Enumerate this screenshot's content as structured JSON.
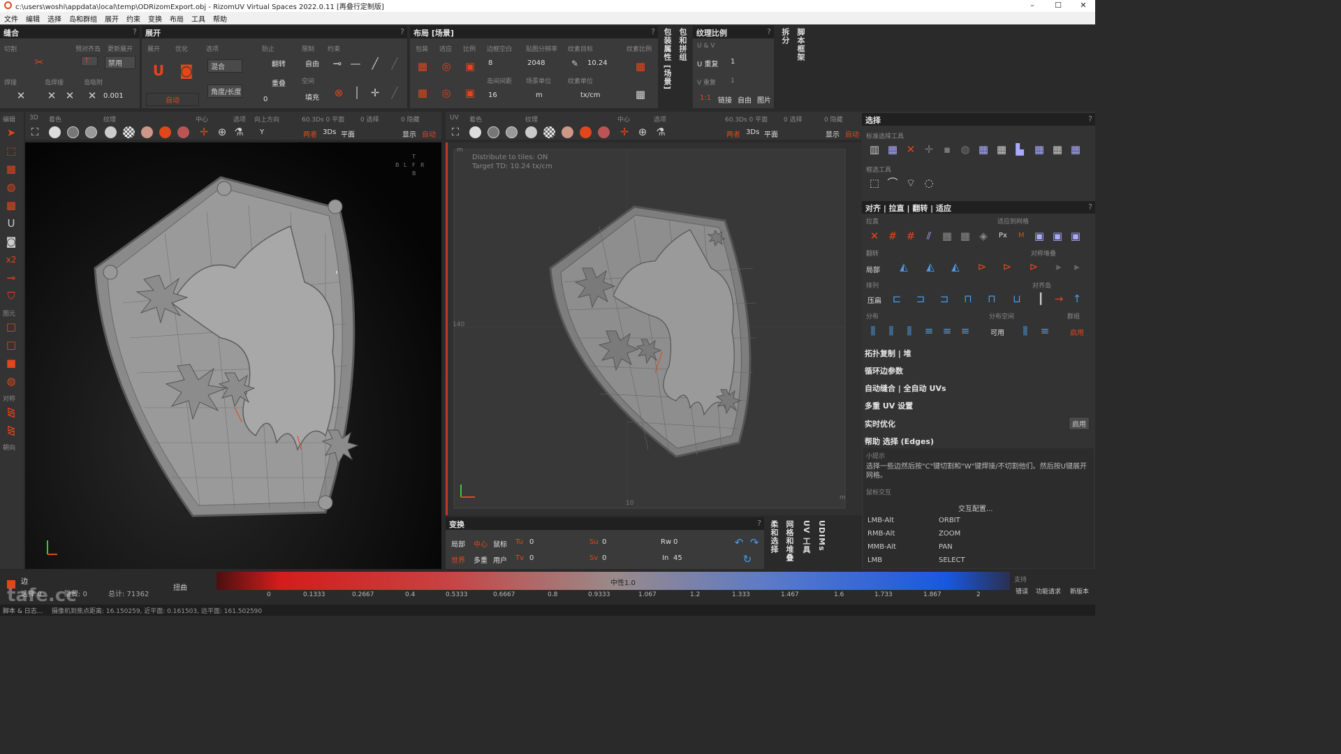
{
  "window": {
    "title": "c:\\users\\woshi\\appdata\\local\\temp\\ODRizomExport.obj - RizomUV Virtual Spaces 2022.0.11 [再叠行定制版]",
    "min": "–",
    "max": "☐",
    "close": "✕"
  },
  "menu": [
    "文件",
    "编辑",
    "选择",
    "岛和群组",
    "展开",
    "约束",
    "变换",
    "布局",
    "工具",
    "帮助"
  ],
  "seams": {
    "title": "缝合",
    "help": "?",
    "cut": "切割",
    "auto_align": "预对齐岛",
    "update_unfold": "更新展开",
    "disabled": "禁用",
    "weld": "焊接",
    "weld_island": "岛焊接",
    "weld_attach": "岛吸附",
    "value": "0.001",
    "t_label": "T"
  },
  "unfold": {
    "title": "展开",
    "help": "?",
    "unfold": "展开",
    "optimize": "优化",
    "options": "选项",
    "prevent": "防止",
    "limit": "限制",
    "constraint": "约束",
    "mix": "混合",
    "angle_len": "角度/长度",
    "flip": "翻转",
    "overlap": "重叠",
    "free": "自由",
    "empty": "空间",
    "fill": "填充",
    "auto": "自动",
    "zero": "0"
  },
  "layout": {
    "title": "布局 [场景]",
    "help": "?",
    "pack": "包装",
    "fit": "适应",
    "ratio": "比例",
    "margin": "边框空白",
    "resolution": "贴图分辨率",
    "texel_target": "纹素目标",
    "texel_ratio": "纹素比例",
    "margin_val": "8",
    "res_val": "2048",
    "td_val": "10.24",
    "spacing": "岛间间距",
    "spacing_val": "16",
    "scene_unit": "场景单位",
    "unit_val": "m",
    "texel_unit": "纹素单位",
    "texel_unit_val": "tx/cm"
  },
  "texel": {
    "title": "纹理比例",
    "help": "?",
    "uv": "U & V",
    "u_repeat": "U 重复",
    "u_val": "1",
    "v_repeat": "V 重复",
    "v_val": "1",
    "ratio": "1:1",
    "link": "链接",
    "free": "自由",
    "image": "图片"
  },
  "vtabs": {
    "pack_props": "包装属性 [场景]",
    "wrap": "包和拼组",
    "unfold_t": "拆分",
    "script": "脚本框架"
  },
  "toolbar3d": {
    "edit": "编辑",
    "view": "3D",
    "color": "着色",
    "texture": "纹理",
    "center": "中心",
    "select": "选项",
    "up": "向上方向",
    "up_val": "Y",
    "info": "60.3Ds 0 平面",
    "sel": "0 选择",
    "hidden": "0 隐藏",
    "both": "两者",
    "d3": "3Ds",
    "flat": "平面",
    "show": "显示",
    "auto": "自动"
  },
  "toolbaruv": {
    "view": "UV",
    "color": "着色",
    "texture": "纹理",
    "center": "中心",
    "select": "选项",
    "info": "60.3Ds 0 平面",
    "sel": "0 选择",
    "hidden": "0 隐藏",
    "both": "两者",
    "d3": "3Ds",
    "flat": "平面",
    "show": "显示",
    "auto": "自动"
  },
  "left_tools": {
    "primitives": "图元",
    "align": "对称",
    "orient": "朝向"
  },
  "viewcube": {
    "t": "T",
    "b": "B",
    "l": "L",
    "f": "F",
    "r": "R",
    "bk": "B"
  },
  "uvview": {
    "distribute": "Distribute to tiles: ON",
    "target": "Target TD: 10.24 tx/cm",
    "y_mark": "140",
    "x_mark": "10",
    "m": "m",
    "m2": "m"
  },
  "transform": {
    "title": "变换",
    "help": "?",
    "local": "局部",
    "center": "中心",
    "mouse": "鼠标",
    "world": "世界",
    "multi": "多重",
    "user": "用户",
    "tu": "Tu",
    "tu_val": "0",
    "tv": "Tv",
    "tv_val": "0",
    "su": "Su",
    "su_val": "0",
    "sv": "Sv",
    "sv_val": "0",
    "rw": "Rw",
    "rw_val": "0",
    "in": "In",
    "in_val": "45"
  },
  "vtabs2": {
    "a": "柔和选择",
    "b": "网格和堆叠",
    "c": "UV 工具",
    "d": "UDIMs"
  },
  "select_panel": {
    "title": "选择",
    "help": "?",
    "std_tools": "标准选择工具",
    "lasso_tools": "框选工具"
  },
  "align_panel": {
    "title": "对齐 | 拉直 | 翻转 | 适应",
    "help": "?",
    "straighten": "拉直",
    "snap_grid": "适应到网格",
    "px": "Px",
    "m": "M",
    "flip": "翻转",
    "local": "局部",
    "sym_stack": "对称堆叠",
    "arrange": "排列",
    "align_to": "对齐岛",
    "compress": "压扁",
    "distribute": "分布",
    "dist_space": "分布空间",
    "group": "群组",
    "usable": "可用",
    "apply": "启用"
  },
  "sections": [
    "拓扑复制 | 堆",
    "循环边参数",
    "自动缝合 | 全自动 UVs",
    "多重 UV 设置",
    "实时优化",
    "帮助 选择 (Edges)"
  ],
  "realtime_btn": "启用",
  "help": {
    "tips": "小提示",
    "text": "选择一些边然后按\"C\"键切割和\"W\"键焊接/不切割他们。然后按U键展开网格。",
    "mouse": "鼠标交互",
    "config": "交互配置...",
    "keys": [
      [
        "LMB-Alt",
        "ORBIT"
      ],
      [
        "RMB-Alt",
        "ZOOM"
      ],
      [
        "MMB-Alt",
        "PAN"
      ],
      [
        "LMB",
        "SELECT"
      ]
    ]
  },
  "status": {
    "edge": "边",
    "selected": "选择:0",
    "hidden": "隐藏: 0",
    "total": "总计: 71362",
    "distort": "扭曲",
    "neutral": "中性1.0",
    "scale": [
      "0",
      "0.1333",
      "0.2667",
      "0.4",
      "0.5333",
      "0.6667",
      "0.8",
      "0.9333",
      "1.067",
      "1.2",
      "1.333",
      "1.467",
      "1.6",
      "1.733",
      "1.867",
      "2"
    ],
    "support": "支持",
    "bug": "错误",
    "feature": "功能请求",
    "version": "新版本",
    "script": "脚本 & 日志...",
    "camera": "摄像机到焦点距离: 16.150259, 近平面: 0.161503, 远平面: 161.502590"
  },
  "watermark": "tafe.cc",
  "colors": {
    "accent": "#e2461b",
    "panel": "#3a3a3a",
    "header": "#202020"
  }
}
